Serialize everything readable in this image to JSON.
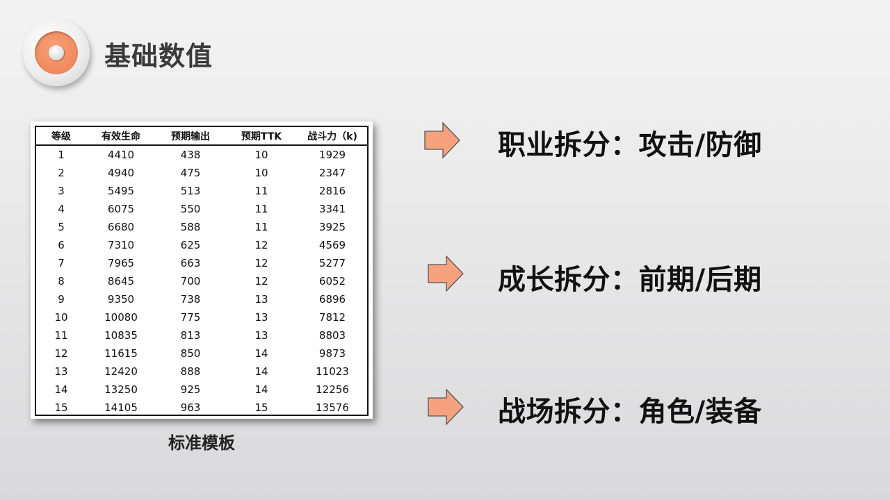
{
  "header": {
    "title": "基础数值"
  },
  "table": {
    "columns": [
      "等级",
      "有效生命",
      "预期输出",
      "预期TTK",
      "战斗力（k)"
    ],
    "rows": [
      [
        "1",
        "4410",
        "438",
        "10",
        "1929"
      ],
      [
        "2",
        "4940",
        "475",
        "10",
        "2347"
      ],
      [
        "3",
        "5495",
        "513",
        "11",
        "2816"
      ],
      [
        "4",
        "6075",
        "550",
        "11",
        "3341"
      ],
      [
        "5",
        "6680",
        "588",
        "11",
        "3925"
      ],
      [
        "6",
        "7310",
        "625",
        "12",
        "4569"
      ],
      [
        "7",
        "7965",
        "663",
        "12",
        "5277"
      ],
      [
        "8",
        "8645",
        "700",
        "12",
        "6052"
      ],
      [
        "9",
        "9350",
        "738",
        "13",
        "6896"
      ],
      [
        "10",
        "10080",
        "775",
        "13",
        "7812"
      ],
      [
        "11",
        "10835",
        "813",
        "13",
        "8803"
      ],
      [
        "12",
        "11615",
        "850",
        "14",
        "9873"
      ],
      [
        "13",
        "12420",
        "888",
        "14",
        "11023"
      ],
      [
        "14",
        "13250",
        "925",
        "14",
        "12256"
      ],
      [
        "15",
        "14105",
        "963",
        "15",
        "13576"
      ]
    ],
    "caption": "标准模板"
  },
  "items": [
    {
      "text": "职业拆分：攻击/防御",
      "icon": "right-arrow-icon"
    },
    {
      "text": "成长拆分：前期/后期",
      "icon": "right-arrow-icon"
    },
    {
      "text": "战场拆分：角色/装备",
      "icon": "right-arrow-icon"
    }
  ],
  "colors": {
    "accent": "#f0895d",
    "arrow_fill": "#f6a27e",
    "title": "#3a3a3a"
  }
}
